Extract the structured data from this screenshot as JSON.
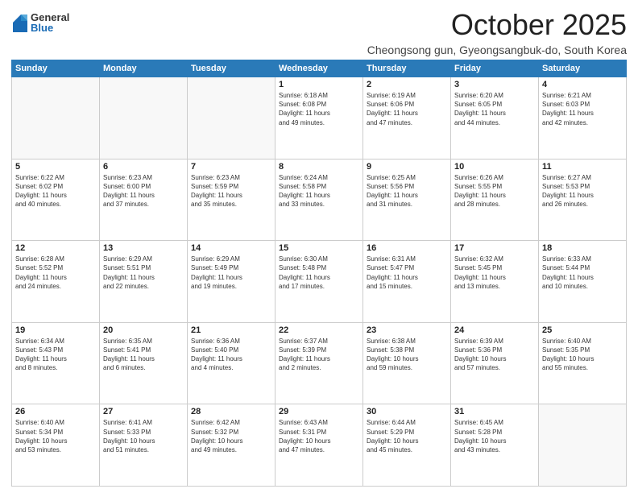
{
  "header": {
    "logo_general": "General",
    "logo_blue": "Blue",
    "month_title": "October 2025",
    "subtitle": "Cheongsong gun, Gyeongsangbuk-do, South Korea"
  },
  "days_of_week": [
    "Sunday",
    "Monday",
    "Tuesday",
    "Wednesday",
    "Thursday",
    "Friday",
    "Saturday"
  ],
  "weeks": [
    [
      {
        "day": "",
        "info": ""
      },
      {
        "day": "",
        "info": ""
      },
      {
        "day": "",
        "info": ""
      },
      {
        "day": "1",
        "info": "Sunrise: 6:18 AM\nSunset: 6:08 PM\nDaylight: 11 hours\nand 49 minutes."
      },
      {
        "day": "2",
        "info": "Sunrise: 6:19 AM\nSunset: 6:06 PM\nDaylight: 11 hours\nand 47 minutes."
      },
      {
        "day": "3",
        "info": "Sunrise: 6:20 AM\nSunset: 6:05 PM\nDaylight: 11 hours\nand 44 minutes."
      },
      {
        "day": "4",
        "info": "Sunrise: 6:21 AM\nSunset: 6:03 PM\nDaylight: 11 hours\nand 42 minutes."
      }
    ],
    [
      {
        "day": "5",
        "info": "Sunrise: 6:22 AM\nSunset: 6:02 PM\nDaylight: 11 hours\nand 40 minutes."
      },
      {
        "day": "6",
        "info": "Sunrise: 6:23 AM\nSunset: 6:00 PM\nDaylight: 11 hours\nand 37 minutes."
      },
      {
        "day": "7",
        "info": "Sunrise: 6:23 AM\nSunset: 5:59 PM\nDaylight: 11 hours\nand 35 minutes."
      },
      {
        "day": "8",
        "info": "Sunrise: 6:24 AM\nSunset: 5:58 PM\nDaylight: 11 hours\nand 33 minutes."
      },
      {
        "day": "9",
        "info": "Sunrise: 6:25 AM\nSunset: 5:56 PM\nDaylight: 11 hours\nand 31 minutes."
      },
      {
        "day": "10",
        "info": "Sunrise: 6:26 AM\nSunset: 5:55 PM\nDaylight: 11 hours\nand 28 minutes."
      },
      {
        "day": "11",
        "info": "Sunrise: 6:27 AM\nSunset: 5:53 PM\nDaylight: 11 hours\nand 26 minutes."
      }
    ],
    [
      {
        "day": "12",
        "info": "Sunrise: 6:28 AM\nSunset: 5:52 PM\nDaylight: 11 hours\nand 24 minutes."
      },
      {
        "day": "13",
        "info": "Sunrise: 6:29 AM\nSunset: 5:51 PM\nDaylight: 11 hours\nand 22 minutes."
      },
      {
        "day": "14",
        "info": "Sunrise: 6:29 AM\nSunset: 5:49 PM\nDaylight: 11 hours\nand 19 minutes."
      },
      {
        "day": "15",
        "info": "Sunrise: 6:30 AM\nSunset: 5:48 PM\nDaylight: 11 hours\nand 17 minutes."
      },
      {
        "day": "16",
        "info": "Sunrise: 6:31 AM\nSunset: 5:47 PM\nDaylight: 11 hours\nand 15 minutes."
      },
      {
        "day": "17",
        "info": "Sunrise: 6:32 AM\nSunset: 5:45 PM\nDaylight: 11 hours\nand 13 minutes."
      },
      {
        "day": "18",
        "info": "Sunrise: 6:33 AM\nSunset: 5:44 PM\nDaylight: 11 hours\nand 10 minutes."
      }
    ],
    [
      {
        "day": "19",
        "info": "Sunrise: 6:34 AM\nSunset: 5:43 PM\nDaylight: 11 hours\nand 8 minutes."
      },
      {
        "day": "20",
        "info": "Sunrise: 6:35 AM\nSunset: 5:41 PM\nDaylight: 11 hours\nand 6 minutes."
      },
      {
        "day": "21",
        "info": "Sunrise: 6:36 AM\nSunset: 5:40 PM\nDaylight: 11 hours\nand 4 minutes."
      },
      {
        "day": "22",
        "info": "Sunrise: 6:37 AM\nSunset: 5:39 PM\nDaylight: 11 hours\nand 2 minutes."
      },
      {
        "day": "23",
        "info": "Sunrise: 6:38 AM\nSunset: 5:38 PM\nDaylight: 10 hours\nand 59 minutes."
      },
      {
        "day": "24",
        "info": "Sunrise: 6:39 AM\nSunset: 5:36 PM\nDaylight: 10 hours\nand 57 minutes."
      },
      {
        "day": "25",
        "info": "Sunrise: 6:40 AM\nSunset: 5:35 PM\nDaylight: 10 hours\nand 55 minutes."
      }
    ],
    [
      {
        "day": "26",
        "info": "Sunrise: 6:40 AM\nSunset: 5:34 PM\nDaylight: 10 hours\nand 53 minutes."
      },
      {
        "day": "27",
        "info": "Sunrise: 6:41 AM\nSunset: 5:33 PM\nDaylight: 10 hours\nand 51 minutes."
      },
      {
        "day": "28",
        "info": "Sunrise: 6:42 AM\nSunset: 5:32 PM\nDaylight: 10 hours\nand 49 minutes."
      },
      {
        "day": "29",
        "info": "Sunrise: 6:43 AM\nSunset: 5:31 PM\nDaylight: 10 hours\nand 47 minutes."
      },
      {
        "day": "30",
        "info": "Sunrise: 6:44 AM\nSunset: 5:29 PM\nDaylight: 10 hours\nand 45 minutes."
      },
      {
        "day": "31",
        "info": "Sunrise: 6:45 AM\nSunset: 5:28 PM\nDaylight: 10 hours\nand 43 minutes."
      },
      {
        "day": "",
        "info": ""
      }
    ]
  ]
}
